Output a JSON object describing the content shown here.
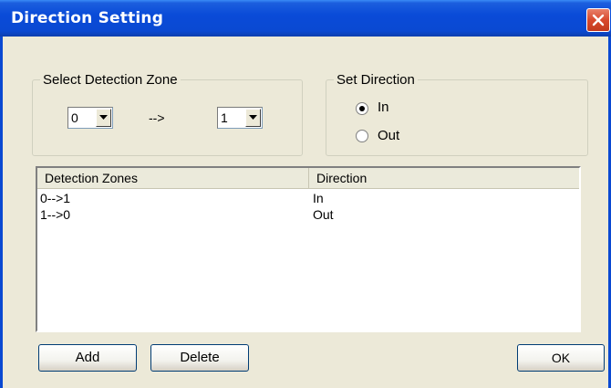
{
  "window": {
    "title": "Direction Setting"
  },
  "zone_group": {
    "legend": "Select Detection Zone",
    "from_value": "0",
    "arrow_label": "-->",
    "to_value": "1"
  },
  "direction_group": {
    "legend": "Set Direction",
    "options": [
      {
        "label": "In",
        "selected": true
      },
      {
        "label": "Out",
        "selected": false
      }
    ]
  },
  "list": {
    "headers": [
      "Detection Zones",
      "Direction"
    ],
    "rows": [
      {
        "zones": "0-->1",
        "direction": "In"
      },
      {
        "zones": "1-->0",
        "direction": "Out"
      }
    ]
  },
  "buttons": {
    "add": "Add",
    "delete": "Delete",
    "ok": "OK"
  },
  "colors": {
    "titlebar": "#0A49D2",
    "face": "#ECE9D8",
    "close": "#D8492D"
  }
}
